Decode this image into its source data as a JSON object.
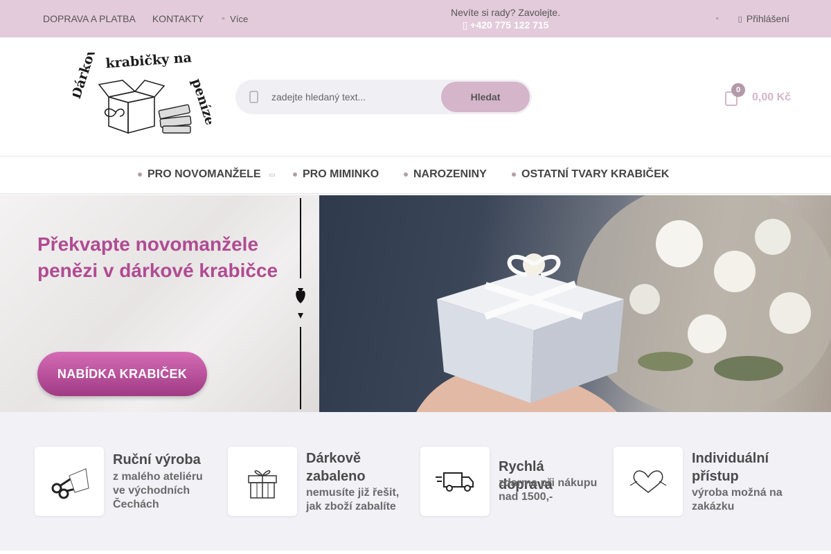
{
  "topbar": {
    "nav": [
      "DOPRAVA A PLATBA",
      "KONTAKTY"
    ],
    "more_label": "Více",
    "contact_text": "Nevíte si rady? Zavolejte.",
    "phone": "+420 775 122 715",
    "login_label": "Přihlášení"
  },
  "logo": {
    "text": "Dárkové krabičky na peníze"
  },
  "search": {
    "placeholder": "zadejte hledaný text...",
    "button_label": "Hledat"
  },
  "cart": {
    "count": "0",
    "total": "0,00 Kč"
  },
  "categories": [
    {
      "label": "PRO NOVOMANŽELE",
      "has_submenu": true
    },
    {
      "label": "PRO MIMINKO",
      "has_submenu": false
    },
    {
      "label": "NAROZENINY",
      "has_submenu": false
    },
    {
      "label": "OSTATNÍ TVARY KRABIČEK",
      "has_submenu": false
    }
  ],
  "hero": {
    "headline": "Překvapte novomanžele penězi v dárkové krabičce",
    "cta_label": "NABÍDKA KRABIČEK"
  },
  "features": [
    {
      "icon": "scissors-icon",
      "title": "Ruční výroba",
      "desc": "z malého ateliéru ve východních Čechách"
    },
    {
      "icon": "gift-icon",
      "title": "Dárkově zabaleno",
      "desc": "nemusíte již řešit, jak zboží zabalíte"
    },
    {
      "icon": "truck-icon",
      "title": "Rychlá doprava",
      "desc": "zdarma při nákupu nad 1500,-"
    },
    {
      "icon": "heart-hands-icon",
      "title": "Individuální přístup",
      "desc": "výroba možná na zakázku"
    }
  ],
  "colors": {
    "topbar_bg": "#e3cbdb",
    "accent": "#b04b92",
    "button_bg": "#d5b5c9",
    "features_bg": "#f1f1f6"
  }
}
